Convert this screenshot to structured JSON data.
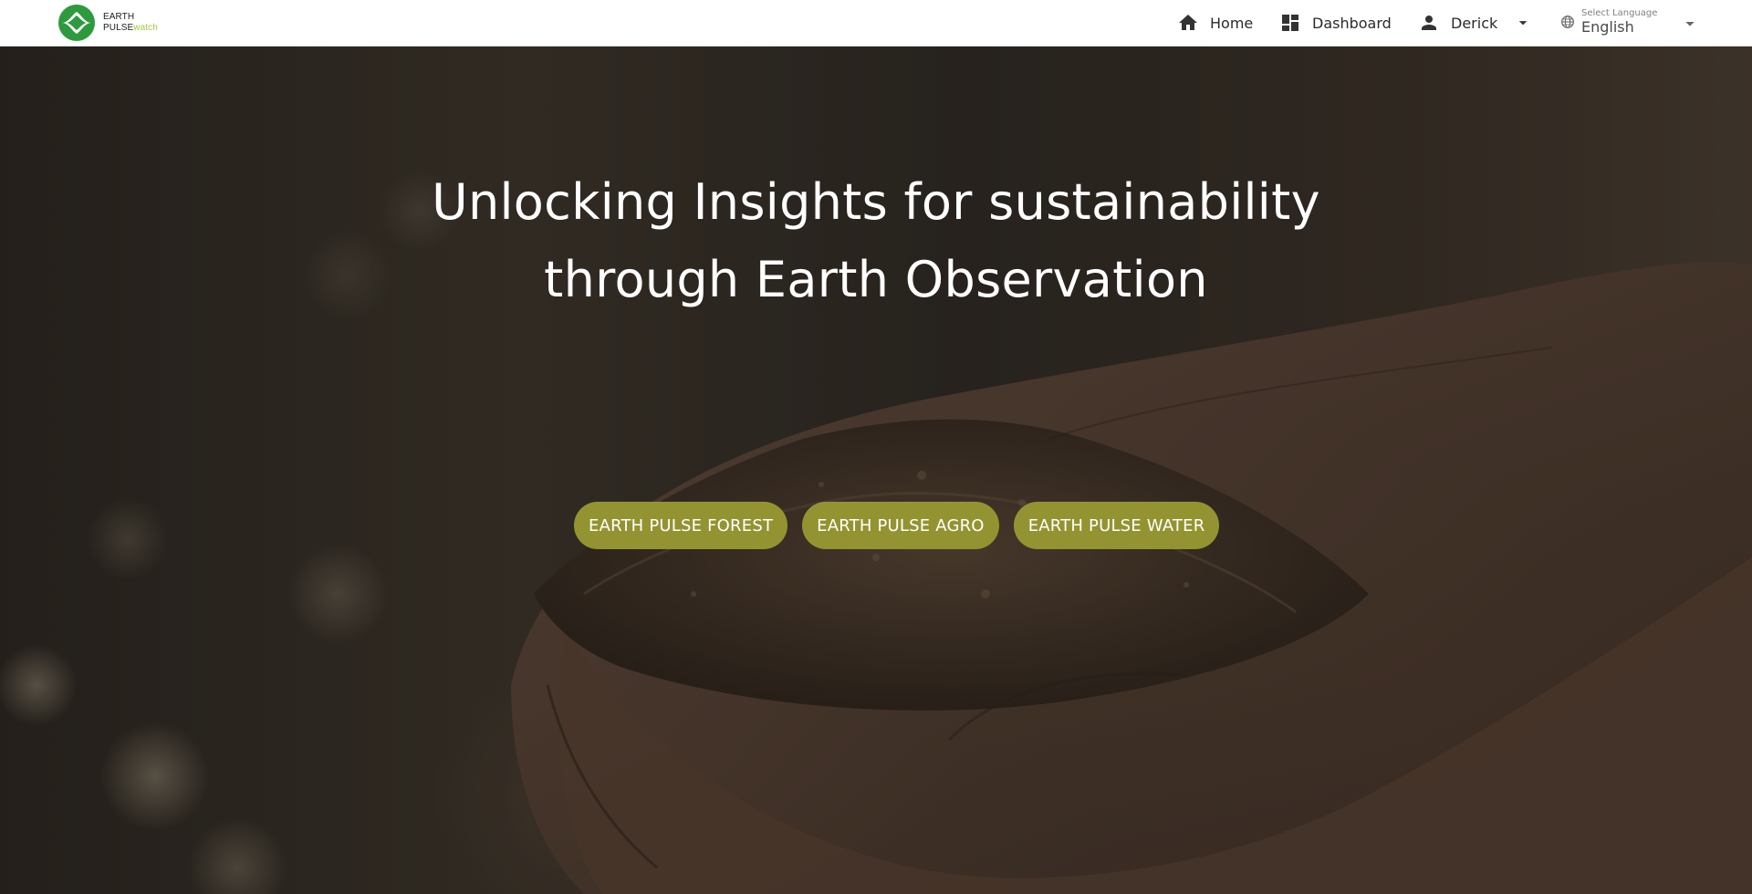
{
  "brand": {
    "line1": "EARTH",
    "line2_main": "PULSE",
    "line2_accent": "watch",
    "accent_color": "#9ccc3c",
    "mark_color": "#2d9a3e"
  },
  "nav": {
    "home": {
      "label": "Home",
      "icon": "home-icon"
    },
    "dashboard": {
      "label": "Dashboard",
      "icon": "dashboard-icon"
    },
    "user": {
      "label": "Derick",
      "icon": "person-icon"
    },
    "language": {
      "caption": "Select Language",
      "value": "English",
      "icon": "globe-icon"
    }
  },
  "hero": {
    "headline_line1": "Unlocking Insights for sustainability",
    "headline_line2": "through Earth Observation",
    "buttons": [
      {
        "label": "EARTH PULSE FOREST"
      },
      {
        "label": "EARTH PULSE AGRO"
      },
      {
        "label": "EARTH PULSE WATER"
      }
    ],
    "button_color": "#939431"
  }
}
